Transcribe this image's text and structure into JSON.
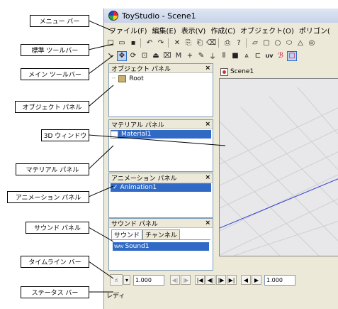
{
  "window": {
    "title": "ToyStudio - Scene1"
  },
  "menu": [
    "ファイル(F)",
    "編集(E)",
    "表示(V)",
    "作成(C)",
    "オブジェクト(O)",
    "ポリゴン("
  ],
  "toolbar_std": [
    "new-icon",
    "open-icon",
    "save-icon",
    "sep",
    "undo-icon",
    "redo-icon",
    "sep",
    "cut-icon",
    "copy-icon",
    "paste-icon",
    "delete-icon",
    "sep",
    "print-icon",
    "help-icon",
    "sep",
    "plane-icon",
    "box-icon",
    "sphere-icon",
    "cylinder-icon",
    "cone-icon",
    "torus-icon"
  ],
  "toolbar_main": [
    "select-icon",
    "move-icon",
    "rotate-icon",
    "scale-icon",
    "extrude-icon",
    "bevel-icon",
    "knife-icon",
    "cross-icon",
    "paint-icon",
    "snap-icon",
    "bar-icon",
    "block-icon",
    "tower-icon",
    "hinge-icon",
    "uv-icon",
    "bone-icon",
    "frame-icon"
  ],
  "toolbar_main_glyphs": [
    "➘",
    "✥",
    "⟳",
    "⊡",
    "⏏",
    "⌧",
    "M",
    "+",
    "✎",
    "⏚",
    "⦀",
    "■",
    "⩓",
    "⊏",
    "uv",
    "ℬ",
    "▢"
  ],
  "toolbar_std_glyphs": [
    "□",
    "▭",
    "▪",
    "↶",
    "↷",
    "✕",
    "⎘",
    "⎗",
    "⌫",
    "⎙",
    "?",
    "▱",
    "▢",
    "○",
    "⬭",
    "△",
    "◎"
  ],
  "panels": {
    "object": {
      "title": "オブジェクト パネル",
      "close": "×",
      "root": "Root"
    },
    "material": {
      "title": "マテリアル パネル",
      "close": "×",
      "item": "Material1"
    },
    "animation": {
      "title": "アニメーション パネル",
      "close": "×",
      "item": "Animation1",
      "check": "✓"
    },
    "sound": {
      "title": "サウンド パネル",
      "close": "×",
      "tabs": [
        "サウンド",
        "チャンネル"
      ],
      "item": "Sound1",
      "item_prefix": "WAV"
    }
  },
  "viewport": {
    "tab": "Scene1"
  },
  "timeline": {
    "field1": "1.000",
    "field2": "1.000",
    "buttons": [
      "◀|",
      "|▶",
      "|◀",
      "◀|",
      "|▶",
      "▶|",
      "◀",
      "▶"
    ]
  },
  "status": {
    "text": "レディ"
  },
  "callouts": {
    "menu_bar": "メニュー バー",
    "standard_toolbar": "標準 ツールバー",
    "main_toolbar": "メイン ツールバー",
    "object_panel": "オブジェクト パネル",
    "view_3d": "3D ウィンドウ",
    "material_panel": "マテリアル パネル",
    "animation_panel": "アニメーション パネル",
    "sound_panel": "サウンド パネル",
    "timeline_bar": "タイムライン バー",
    "status_bar": "ステータス バー"
  }
}
